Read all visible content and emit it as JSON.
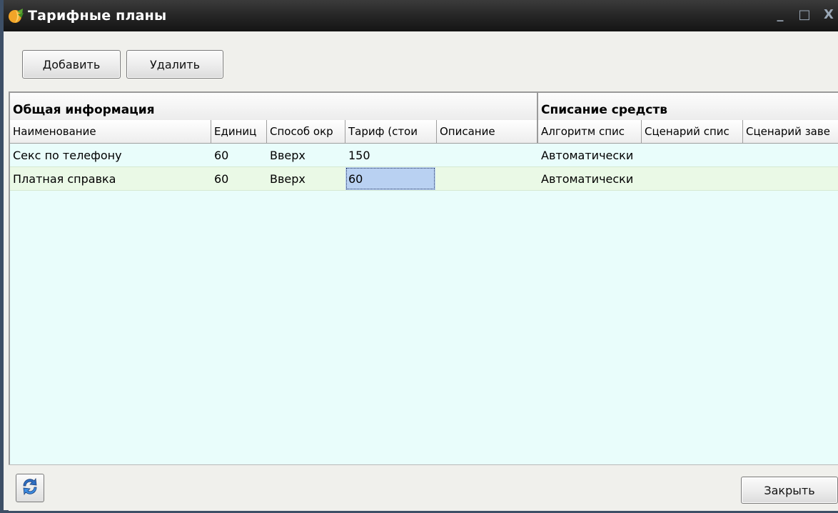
{
  "window": {
    "title": "Тарифные планы",
    "controls": {
      "minimize": "_",
      "maximize": "□",
      "close": "X"
    }
  },
  "toolbar": {
    "add_label": "Добавить",
    "delete_label": "Удалить"
  },
  "grid": {
    "bands": [
      "Общая информация",
      "Списание средств"
    ],
    "columns": [
      "Наименование",
      "Единиц",
      "Способ окр",
      "Тариф (стои",
      "Описание",
      "Алгоритм спис",
      "Сценарий спис",
      "Сценарий заве"
    ],
    "rows": [
      [
        "Секс по телефону",
        "60",
        "Вверх",
        "150",
        "",
        "Автоматически",
        "",
        ""
      ],
      [
        "Платная справка",
        "60",
        "Вверх",
        "60",
        "",
        "Автоматически",
        "",
        ""
      ]
    ],
    "selected": {
      "row": 1,
      "column": 3
    }
  },
  "footer": {
    "close_label": "Закрыть",
    "refresh_icon": "refresh-icon"
  },
  "colors": {
    "grid_background": "#e9fdfb",
    "alt_row": "#eaf9e6",
    "selection": "#b9d1f2",
    "titlebar": "#262626"
  }
}
